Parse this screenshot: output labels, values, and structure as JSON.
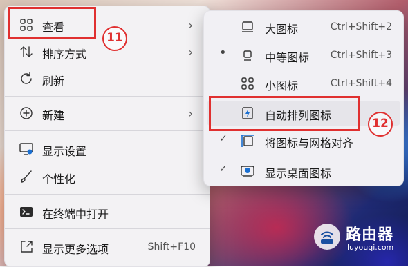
{
  "main_menu": {
    "items": [
      {
        "label": "查看",
        "icon": "grid-icon",
        "has_submenu": true
      },
      {
        "label": "排序方式",
        "icon": "sort-icon",
        "has_submenu": true
      },
      {
        "label": "刷新",
        "icon": "refresh-icon"
      },
      {
        "label": "新建",
        "icon": "new-icon",
        "has_submenu": true
      },
      {
        "label": "显示设置",
        "icon": "display-settings-icon"
      },
      {
        "label": "个性化",
        "icon": "brush-icon"
      },
      {
        "label": "在终端中打开",
        "icon": "terminal-icon"
      },
      {
        "label": "显示更多选项",
        "icon": "more-options-icon",
        "shortcut": "Shift+F10"
      }
    ],
    "arrow": "›"
  },
  "sub_menu": {
    "items": [
      {
        "label": "大图标",
        "icon": "large-icons-icon",
        "shortcut": "Ctrl+Shift+2"
      },
      {
        "label": "中等图标",
        "icon": "medium-icons-icon",
        "shortcut": "Ctrl+Shift+3",
        "mark": "•"
      },
      {
        "label": "小图标",
        "icon": "small-icons-icon",
        "shortcut": "Ctrl+Shift+4"
      },
      {
        "label": "自动排列图标",
        "icon": "auto-arrange-icon"
      },
      {
        "label": "将图标与网格对齐",
        "icon": "align-grid-icon",
        "mark": "✓"
      },
      {
        "label": "显示桌面图标",
        "icon": "show-desktop-icons-icon",
        "mark": "✓"
      }
    ]
  },
  "annotations": {
    "badge_11": "11",
    "badge_12": "12",
    "color": "#e03030"
  },
  "watermark": {
    "title": "路由器",
    "url": "luyouqi.com"
  }
}
